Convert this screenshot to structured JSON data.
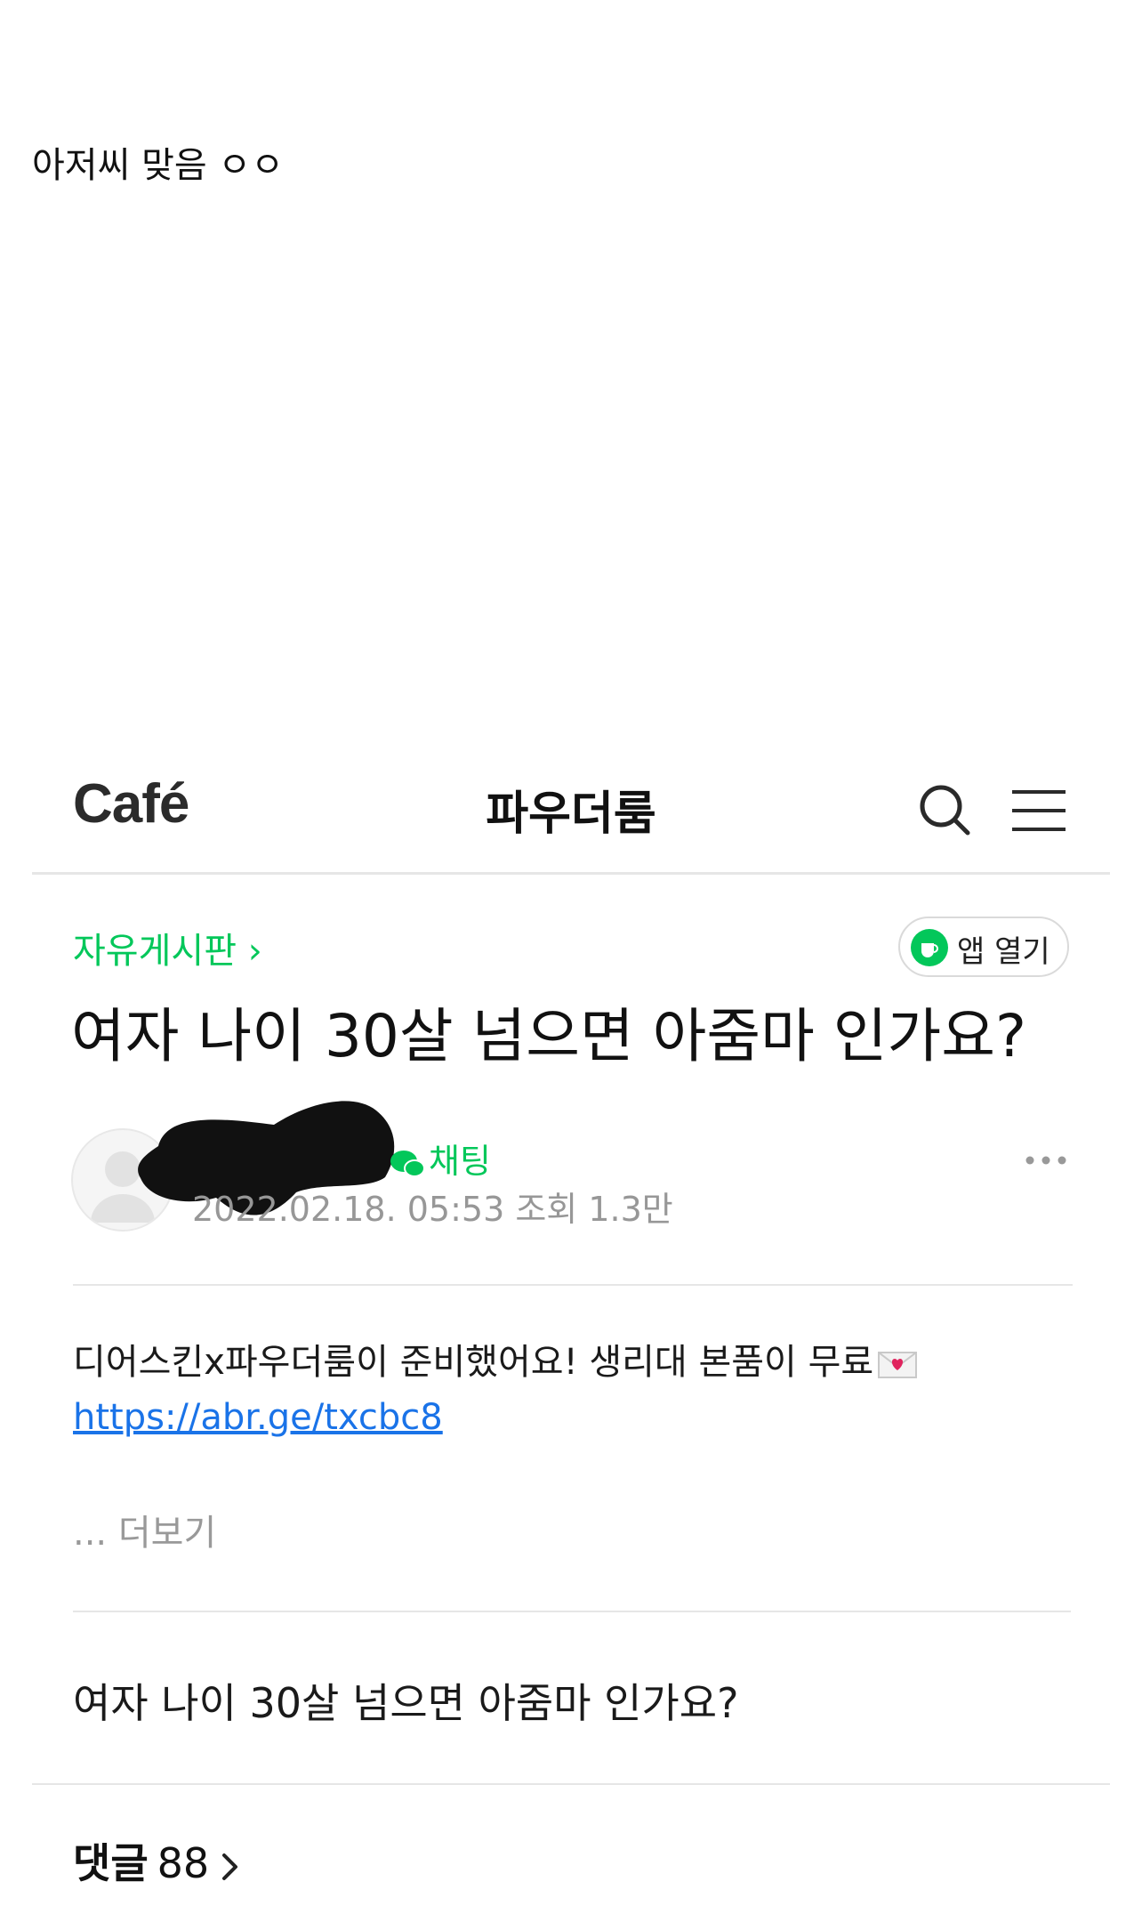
{
  "caption": "아저씨 맞음 ㅇㅇ",
  "header": {
    "logo": "Café",
    "cafe_name": "파우더룸"
  },
  "board": {
    "name": "자유게시판 ›",
    "app_open_label": "앱 열기"
  },
  "post": {
    "title": "여자 나이 30살 넘으면 아줌마 인가요?",
    "chat_label": "채팅",
    "meta": "2022.02.18. 05:53  조회 1.3만",
    "promo_text": "디어스킨x파우더룸이 준비했어요! 생리대 본품이 무료",
    "promo_link": "https://abr.ge/txcbc8",
    "more_label": "... 더보기",
    "body": "여자 나이 30살 넘으면 아줌마 인가요?"
  },
  "comments": {
    "label": "댓글",
    "count": "88"
  },
  "colors": {
    "brand_green": "#03c75a",
    "link_blue": "#1a73e8",
    "meta_gray": "#979797"
  }
}
